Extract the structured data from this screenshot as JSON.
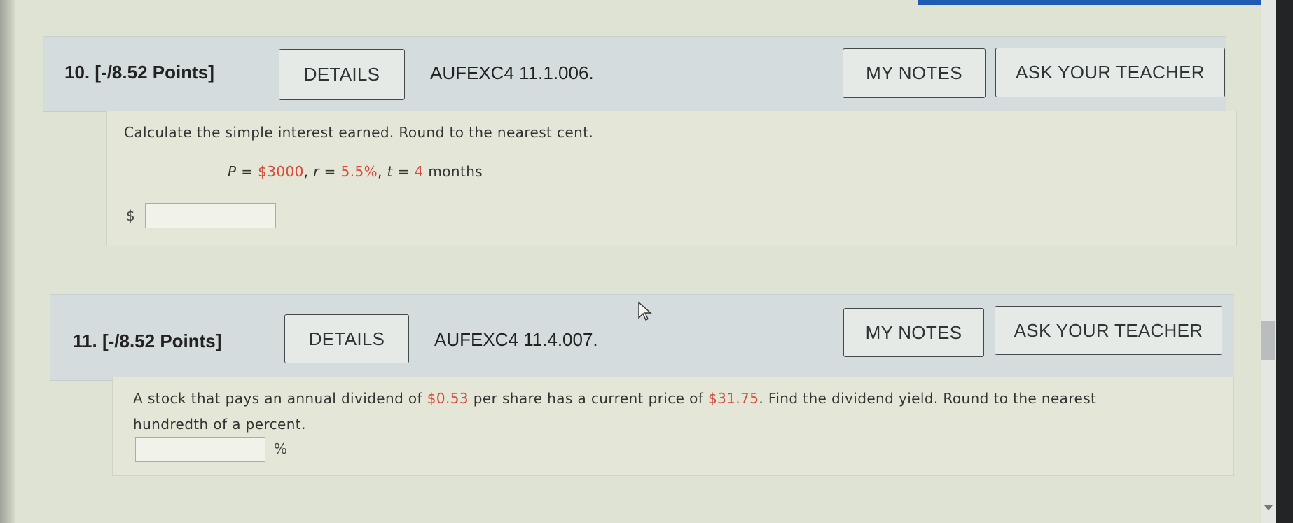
{
  "questions": [
    {
      "number": "10.",
      "points": "[-/8.52 Points]",
      "details_label": "DETAILS",
      "problem_id": "AUFEXC4 11.1.006.",
      "notes_label": "MY NOTES",
      "ask_label": "ASK YOUR TEACHER",
      "prompt": "Calculate the simple interest earned. Round to the nearest cent.",
      "given": {
        "P_var": "P",
        "P_eq": " = ",
        "P_val": "$3000",
        "sep1": ", ",
        "r_var": "r",
        "r_eq": " = ",
        "r_val": "5.5%",
        "sep2": ", ",
        "t_var": "t",
        "t_eq": " = ",
        "t_val": "4",
        "t_unit": " months"
      },
      "answer_prefix": "$",
      "answer_value": ""
    },
    {
      "number": "11.",
      "points": "[-/8.52 Points]",
      "details_label": "DETAILS",
      "problem_id": "AUFEXC4 11.4.007.",
      "notes_label": "MY NOTES",
      "ask_label": "ASK YOUR TEACHER",
      "prompt_part1": "A stock that pays an annual dividend of ",
      "dividend": "$0.53",
      "prompt_part2": " per share has a current price of ",
      "price": "$31.75",
      "prompt_part3": ". Find the dividend yield. Round to the nearest",
      "prompt_line2": "hundredth of a percent.",
      "answer_value": "",
      "answer_suffix": "%"
    }
  ],
  "icons": {
    "cursor": "mouse-pointer-icon",
    "scroll_down": "chevron-down-icon"
  },
  "colors": {
    "accent_red": "#d64a3a",
    "header_bg": "#d5dcde",
    "body_bg": "#e4e7d8"
  }
}
